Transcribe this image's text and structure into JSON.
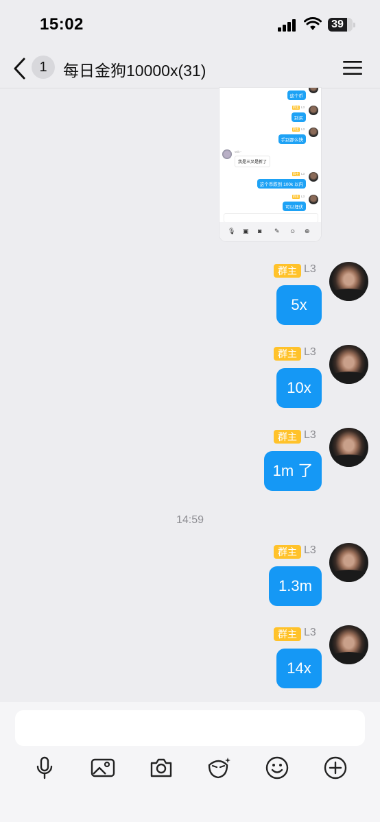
{
  "status": {
    "time": "15:02",
    "battery": "39"
  },
  "nav": {
    "unread_count": "1",
    "title": "每日金狗10000x(31)"
  },
  "shot": {
    "messages": [
      "这个币",
      "别买",
      "手别那么快",
      "这个币跌到 100k 以内",
      "可以埋伏"
    ],
    "incoming_name": "Wik~",
    "incoming_text": "我是三叉是新了",
    "tag_role": "群主",
    "tag_level": "L3"
  },
  "messages": [
    {
      "role": "群主",
      "level": "L3",
      "text": "5x"
    },
    {
      "role": "群主",
      "level": "L3",
      "text": "10x"
    },
    {
      "role": "群主",
      "level": "L3",
      "text": "1m 了"
    },
    {
      "role": "群主",
      "level": "L3",
      "text": "1.3m"
    },
    {
      "role": "群主",
      "level": "L3",
      "text": "14x"
    }
  ],
  "timestamp": "14:59",
  "toolbar": [
    "mic-icon",
    "image-icon",
    "camera-icon",
    "sticker-icon",
    "emoji-icon",
    "plus-icon"
  ]
}
